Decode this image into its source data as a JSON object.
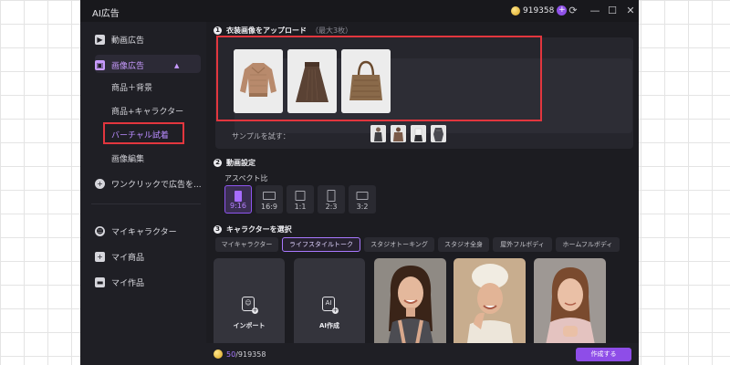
{
  "app": {
    "title": "AI広告"
  },
  "titlebar": {
    "balance": "919358",
    "icons": [
      "refresh-icon",
      "minimize-icon",
      "maximize-icon",
      "close-icon"
    ]
  },
  "sidebar": {
    "video_ad": "動画広告",
    "image_ad": "画像広告",
    "image_sub": [
      "商品＋背景",
      "商品+キャラクター",
      "バーチャル試着",
      "画像編集"
    ],
    "one_click": "ワンクリックで広告を...",
    "my_characters": "マイキャラクター",
    "my_products": "マイ商品",
    "my_works": "マイ作品"
  },
  "step1": {
    "title": "衣装画像をアップロード",
    "limit": "（最大3枚）",
    "items": [
      "sweater",
      "skirt",
      "tote-bag"
    ],
    "sample_label": "サンプルを試す："
  },
  "step2": {
    "title": "動画設定",
    "aspect_label": "アスペクト比",
    "aspects": [
      "9:16",
      "16:9",
      "1:1",
      "2:3",
      "3:2"
    ],
    "selected_aspect": "9:16"
  },
  "step3": {
    "title": "キャラクターを選択",
    "tabs": [
      "マイキャラクター",
      "ライフスタイルトーク",
      "スタジオトーキング",
      "スタジオ全身",
      "屋外フルボディ",
      "ホームフルボディ"
    ],
    "selected_tab": "ライフスタイルトーク",
    "import_label": "インポート",
    "ai_create_label": "AI作成",
    "ai_icon_text": "AI"
  },
  "bottom": {
    "used": "50",
    "total": "/919358",
    "create_button": "作成する"
  },
  "colors": {
    "accent": "#8e4de8",
    "highlight": "#e2363e",
    "background": "#1c1c21"
  }
}
